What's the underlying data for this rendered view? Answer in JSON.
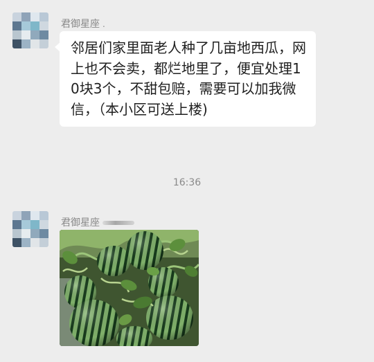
{
  "messages": [
    {
      "sender": "君御星座",
      "sender_suffix": ".",
      "text": "邻居们家里面老人种了几亩地西瓜，网上也不会卖，都烂地里了，便宜处理10块3个，不甜包赔，需要可以加我微信，（本小区可送上楼)"
    },
    {
      "sender": "君御星座",
      "image_subject": "watermelons-photo"
    }
  ],
  "timestamp": "16:36",
  "colors": {
    "background": "#ededed",
    "bubble": "#ffffff",
    "text": "#1f1f1f",
    "meta": "#888888"
  }
}
